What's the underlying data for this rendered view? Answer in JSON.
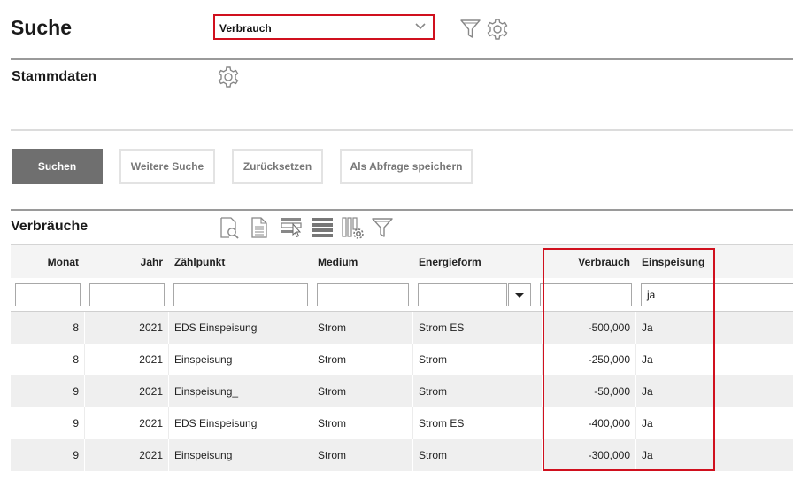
{
  "header": {
    "title": "Suche",
    "select_value": "Verbrauch"
  },
  "stammdaten": {
    "title": "Stammdaten"
  },
  "buttons": {
    "search": "Suchen",
    "more": "Weitere Suche",
    "reset": "Zurücksetzen",
    "save_query": "Als Abfrage speichern"
  },
  "table": {
    "title": "Verbräuche",
    "columns": [
      "Monat",
      "Jahr",
      "Zählpunkt",
      "Medium",
      "Energieform",
      "Verbrauch",
      "Einspeisung"
    ],
    "filters": {
      "monat": "",
      "jahr": "",
      "zaehlpunkt": "",
      "medium": "",
      "energieform": "",
      "verbrauch": "",
      "einspeisung": "ja"
    },
    "rows": [
      [
        "8",
        "2021",
        "EDS Einspeisung",
        "Strom",
        "Strom ES",
        "-500,000",
        "Ja"
      ],
      [
        "8",
        "2021",
        "Einspeisung",
        "Strom",
        "Strom",
        "-250,000",
        "Ja"
      ],
      [
        "9",
        "2021",
        "Einspeisung_",
        "Strom",
        "Strom",
        "-50,000",
        "Ja"
      ],
      [
        "9",
        "2021",
        "EDS Einspeisung",
        "Strom",
        "Strom ES",
        "-400,000",
        "Ja"
      ],
      [
        "9",
        "2021",
        "Einspeisung",
        "Strom",
        "Strom",
        "-300,000",
        "Ja"
      ]
    ]
  },
  "icons": [
    "funnel-icon",
    "gear-icon",
    "print-preview-icon",
    "document-icon",
    "row-select-icon",
    "rows-icon",
    "column-settings-icon",
    "filter-icon"
  ],
  "colors": {
    "highlight": "#d0101e",
    "primary_button": "#6f6f6f",
    "row_stripe": "#efefef"
  }
}
